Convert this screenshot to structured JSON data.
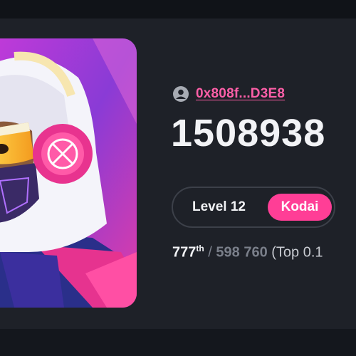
{
  "profile": {
    "address": "0x808f...D3E8",
    "score": "1508938",
    "level_label": "Level 12",
    "tier_label": "Kodai",
    "rank": {
      "position": "777",
      "position_suffix": "th",
      "separator": "/",
      "total": "598 760",
      "top_text": "(Top 0.1"
    }
  },
  "colors": {
    "accent_pink": "#ff3e96",
    "link_pink": "#ff5fa8",
    "panel_bg": "#1e2128"
  },
  "icons": {
    "user": "user-circle-icon"
  }
}
